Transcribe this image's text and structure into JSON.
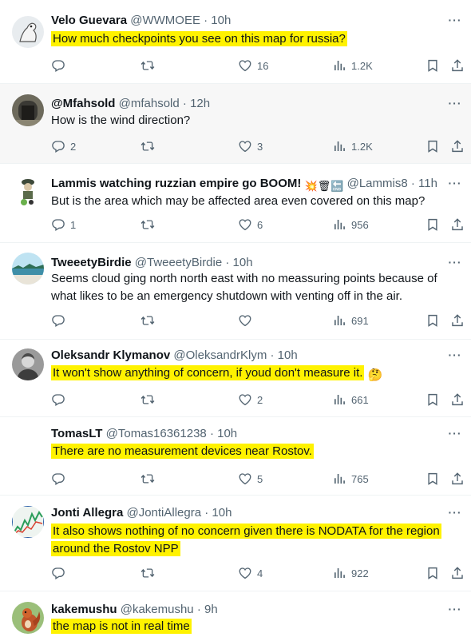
{
  "tweets": [
    {
      "name": "Velo Guevara",
      "handle": "@WWMOEE",
      "time": "· 10h",
      "text": "How much checkpoints you see on this map for russia?",
      "replies": "",
      "retweets": "",
      "likes": "16",
      "views": "1.2K"
    },
    {
      "name": "@Mfahsold",
      "handle": "@mfahsold",
      "time": "· 12h",
      "text": "How is the wind direction?",
      "replies": "2",
      "retweets": "",
      "likes": "3",
      "views": "1.2K"
    },
    {
      "name": "Lammis watching ruzzian empire go BOOM!",
      "name_emoji": "💥🗑🔚",
      "handle": "@Lammis8",
      "time": "· 11h",
      "text": "But is the area which may be affected area even covered on this map?",
      "replies": "1",
      "retweets": "",
      "likes": "6",
      "views": "956"
    },
    {
      "name": "TweeetyBirdie",
      "handle": "@TweeetyBirdie",
      "time": "· 10h",
      "text": "Seems cloud ging north north east with no meassuring points because  of what likes to be an emergency shutdown with venting off in the air.",
      "replies": "",
      "retweets": "",
      "likes": "",
      "views": "691"
    },
    {
      "name": "Oleksandr Klymanov",
      "handle": "@OleksandrKlym",
      "time": "· 10h",
      "text": "It won't show anything of concern, if youd don't measure it.",
      "text_emoji": "🤔",
      "replies": "",
      "retweets": "",
      "likes": "2",
      "views": "661"
    },
    {
      "name": "TomasLT",
      "handle": "@Tomas16361238",
      "time": "· 10h",
      "text": "There are no measurement devices near Rostov.",
      "replies": "",
      "retweets": "",
      "likes": "5",
      "views": "765"
    },
    {
      "name": "Jonti Allegra",
      "handle": "@JontiAllegra",
      "time": "· 10h",
      "text_line1": "It also shows nothing of no concern given there is NODATA for the region",
      "text_line2": "around the Rostov NPP",
      "replies": "",
      "retweets": "",
      "likes": "4",
      "views": "922"
    },
    {
      "name": "kakemushu",
      "handle": "@kakemushu",
      "time": "· 9h",
      "text": "the map is not in real time"
    }
  ],
  "colors": {
    "highlight": "#fff200",
    "secondary_text": "#536471",
    "hover_bg": "#f7f7f7"
  },
  "icons": [
    "reply-icon",
    "retweet-icon",
    "like-icon",
    "views-icon",
    "bookmark-icon",
    "share-icon",
    "more-icon"
  ]
}
